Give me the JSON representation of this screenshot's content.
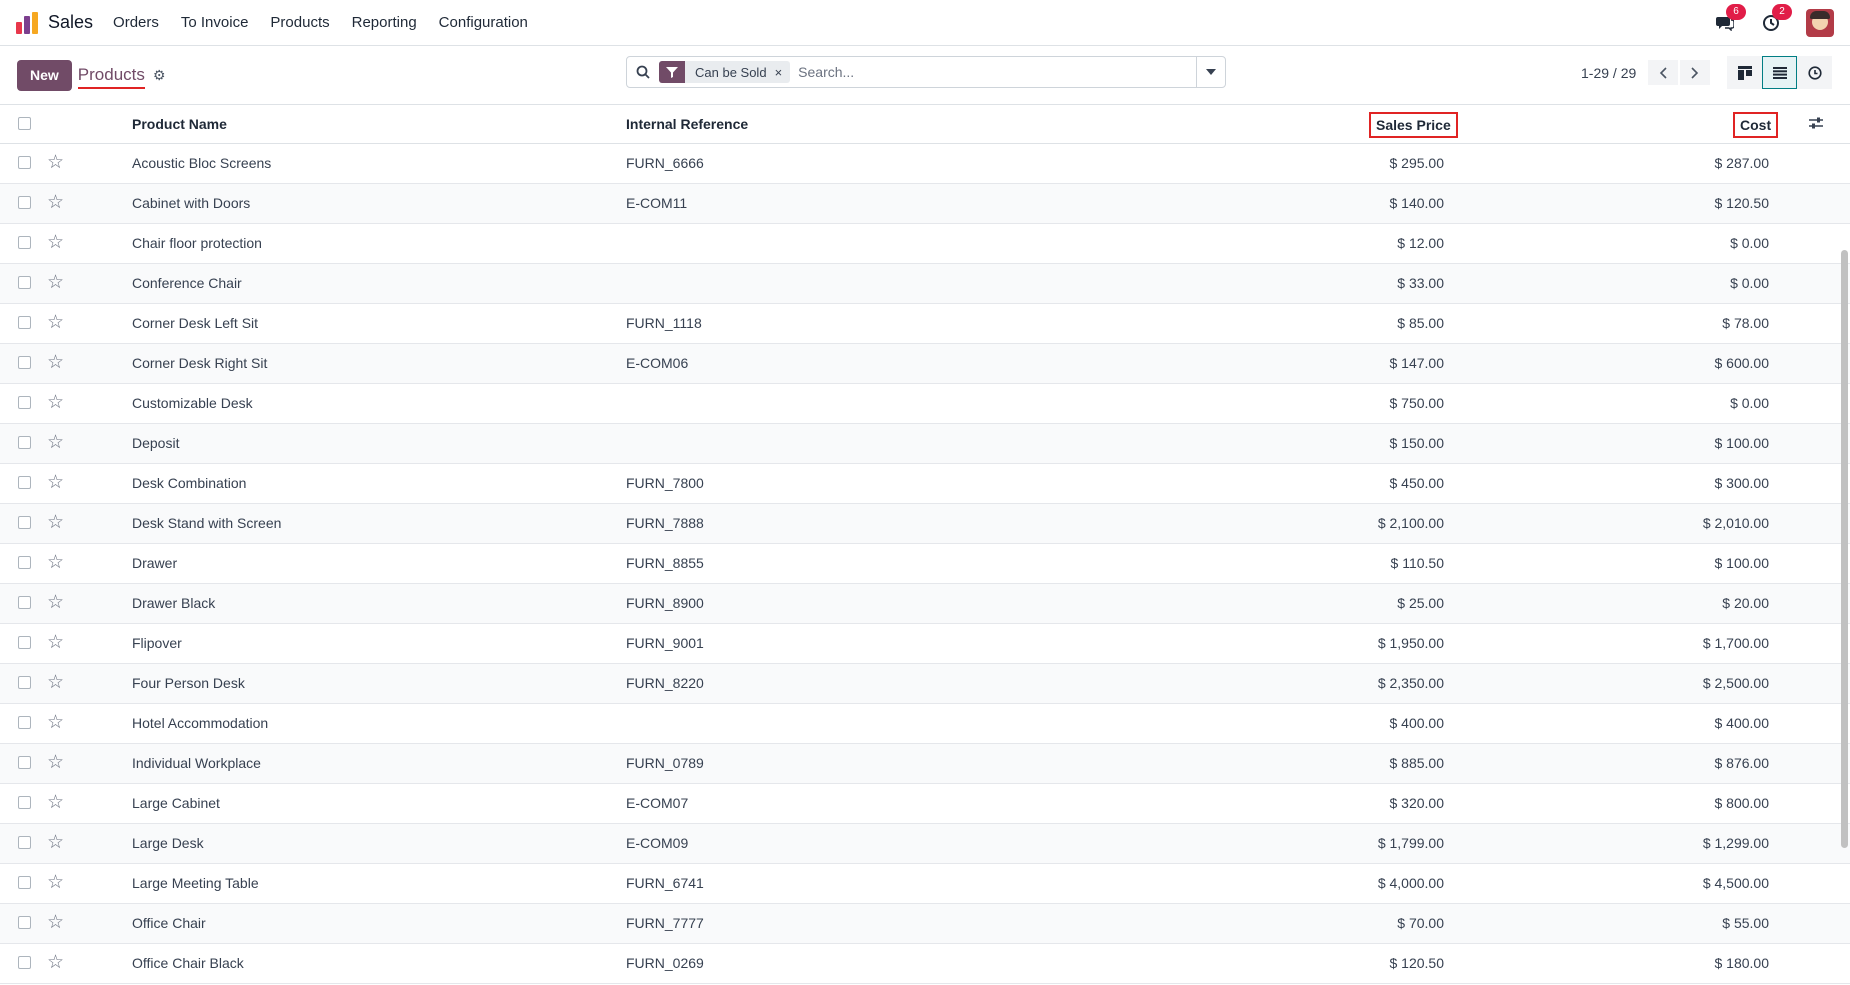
{
  "navbar": {
    "app_name": "Sales",
    "menu": [
      "Orders",
      "To Invoice",
      "Products",
      "Reporting",
      "Configuration"
    ],
    "messages_count": "6",
    "activities_count": "2"
  },
  "control": {
    "new_label": "New",
    "title": "Products",
    "facet_label": "Can be Sold",
    "facet_remove": "×",
    "search_placeholder": "Search...",
    "pager": "1-29 / 29"
  },
  "table": {
    "columns": {
      "name": "Product Name",
      "ref": "Internal Reference",
      "price": "Sales Price",
      "cost": "Cost"
    },
    "rows": [
      {
        "name": "Acoustic Bloc Screens",
        "ref": "FURN_6666",
        "price": "$ 295.00",
        "cost": "$ 287.00"
      },
      {
        "name": "Cabinet with Doors",
        "ref": "E-COM11",
        "price": "$ 140.00",
        "cost": "$ 120.50"
      },
      {
        "name": "Chair floor protection",
        "ref": "",
        "price": "$ 12.00",
        "cost": "$ 0.00"
      },
      {
        "name": "Conference Chair",
        "ref": "",
        "price": "$ 33.00",
        "cost": "$ 0.00"
      },
      {
        "name": "Corner Desk Left Sit",
        "ref": "FURN_1118",
        "price": "$ 85.00",
        "cost": "$ 78.00"
      },
      {
        "name": "Corner Desk Right Sit",
        "ref": "E-COM06",
        "price": "$ 147.00",
        "cost": "$ 600.00"
      },
      {
        "name": "Customizable Desk",
        "ref": "",
        "price": "$ 750.00",
        "cost": "$ 0.00"
      },
      {
        "name": "Deposit",
        "ref": "",
        "price": "$ 150.00",
        "cost": "$ 100.00"
      },
      {
        "name": "Desk Combination",
        "ref": "FURN_7800",
        "price": "$ 450.00",
        "cost": "$ 300.00"
      },
      {
        "name": "Desk Stand with Screen",
        "ref": "FURN_7888",
        "price": "$ 2,100.00",
        "cost": "$ 2,010.00"
      },
      {
        "name": "Drawer",
        "ref": "FURN_8855",
        "price": "$ 110.50",
        "cost": "$ 100.00"
      },
      {
        "name": "Drawer Black",
        "ref": "FURN_8900",
        "price": "$ 25.00",
        "cost": "$ 20.00"
      },
      {
        "name": "Flipover",
        "ref": "FURN_9001",
        "price": "$ 1,950.00",
        "cost": "$ 1,700.00"
      },
      {
        "name": "Four Person Desk",
        "ref": "FURN_8220",
        "price": "$ 2,350.00",
        "cost": "$ 2,500.00"
      },
      {
        "name": "Hotel Accommodation",
        "ref": "",
        "price": "$ 400.00",
        "cost": "$ 400.00"
      },
      {
        "name": "Individual Workplace",
        "ref": "FURN_0789",
        "price": "$ 885.00",
        "cost": "$ 876.00"
      },
      {
        "name": "Large Cabinet",
        "ref": "E-COM07",
        "price": "$ 320.00",
        "cost": "$ 800.00"
      },
      {
        "name": "Large Desk",
        "ref": "E-COM09",
        "price": "$ 1,799.00",
        "cost": "$ 1,299.00"
      },
      {
        "name": "Large Meeting Table",
        "ref": "FURN_6741",
        "price": "$ 4,000.00",
        "cost": "$ 4,500.00"
      },
      {
        "name": "Office Chair",
        "ref": "FURN_7777",
        "price": "$ 70.00",
        "cost": "$ 55.00"
      },
      {
        "name": "Office Chair Black",
        "ref": "FURN_0269",
        "price": "$ 120.50",
        "cost": "$ 180.00"
      }
    ]
  },
  "colors": {
    "brand": "#714b67",
    "highlight": "#e02424",
    "active_view": "#017e84"
  }
}
